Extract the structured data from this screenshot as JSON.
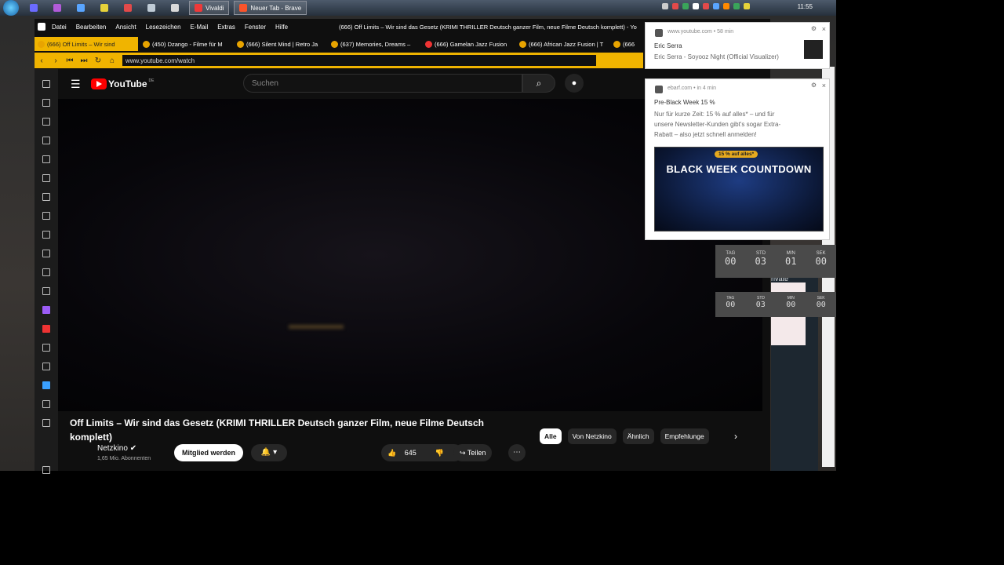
{
  "taskbar": {
    "tasks": [
      "Vivaldi",
      "Neuer Tab - Brave"
    ],
    "clock": "11:55"
  },
  "browser": {
    "menu": [
      "Datei",
      "Bearbeiten",
      "Ansicht",
      "Lesezeichen",
      "E-Mail",
      "Extras",
      "Fenster",
      "Hilfe"
    ],
    "window_title": "(666) Off Limits – Wir sind das Gesetz (KRIMI THRILLER Deutsch ganzer Film, neue Filme Deutsch komplett) - Yo",
    "tabs": [
      "(666) Off Limits – Wir sind",
      "(450) Dzango - Filme für M",
      "(666) Silent Mind | Retro Ja",
      "(637) Memories, Dreams –",
      "(666) Gamelan Jazz Fusion",
      "(666) African Jazz Fusion | T",
      "(666"
    ],
    "url": "www.youtube.com/watch"
  },
  "youtube": {
    "logo_word": "YouTube",
    "logo_region": "DE",
    "search_placeholder": "Suchen",
    "video_title": "Off Limits – Wir sind das Gesetz (KRIMI THRILLER Deutsch ganzer Film, neue Filme Deutsch komplett)",
    "channel": "Netzkino",
    "subscribers": "1,65 Mio. Abonnenten",
    "member_button": "Mitglied werden",
    "likes": "645",
    "share": "Teilen",
    "chips": [
      "Alle",
      "Von Netzkino",
      "Ähnlich",
      "Empfehlunge"
    ]
  },
  "notifications": [
    {
      "source": "www.youtube.com",
      "time": "58 min",
      "title": "Eric Serra",
      "body": "Eric Serra - Soyooz Night (Official Visualizer)"
    },
    {
      "source": "ebarf.com",
      "time": "in 4 min",
      "title": "Pre-Black Week 15 %",
      "body": "Nur für kurze Zeit: 15 % auf alles* – und für unsere Newsletter-Kunden gibt's sogar Extra-Rabatt – also jetzt schnell anmelden!",
      "banner_pill": "15 % auf alles*",
      "banner_text": "BLACK WEEK COUNTDOWN"
    }
  ],
  "timers": [
    {
      "labels": [
        "TAG",
        "STD",
        "MIN",
        "SEK"
      ],
      "values": [
        "00",
        "03",
        "01",
        "00"
      ]
    },
    {
      "labels": [
        "TAG",
        "STD",
        "MIN",
        "SEK"
      ],
      "values": [
        "00",
        "03",
        "00",
        "00"
      ]
    }
  ],
  "background_window": {
    "text": "rivate"
  }
}
